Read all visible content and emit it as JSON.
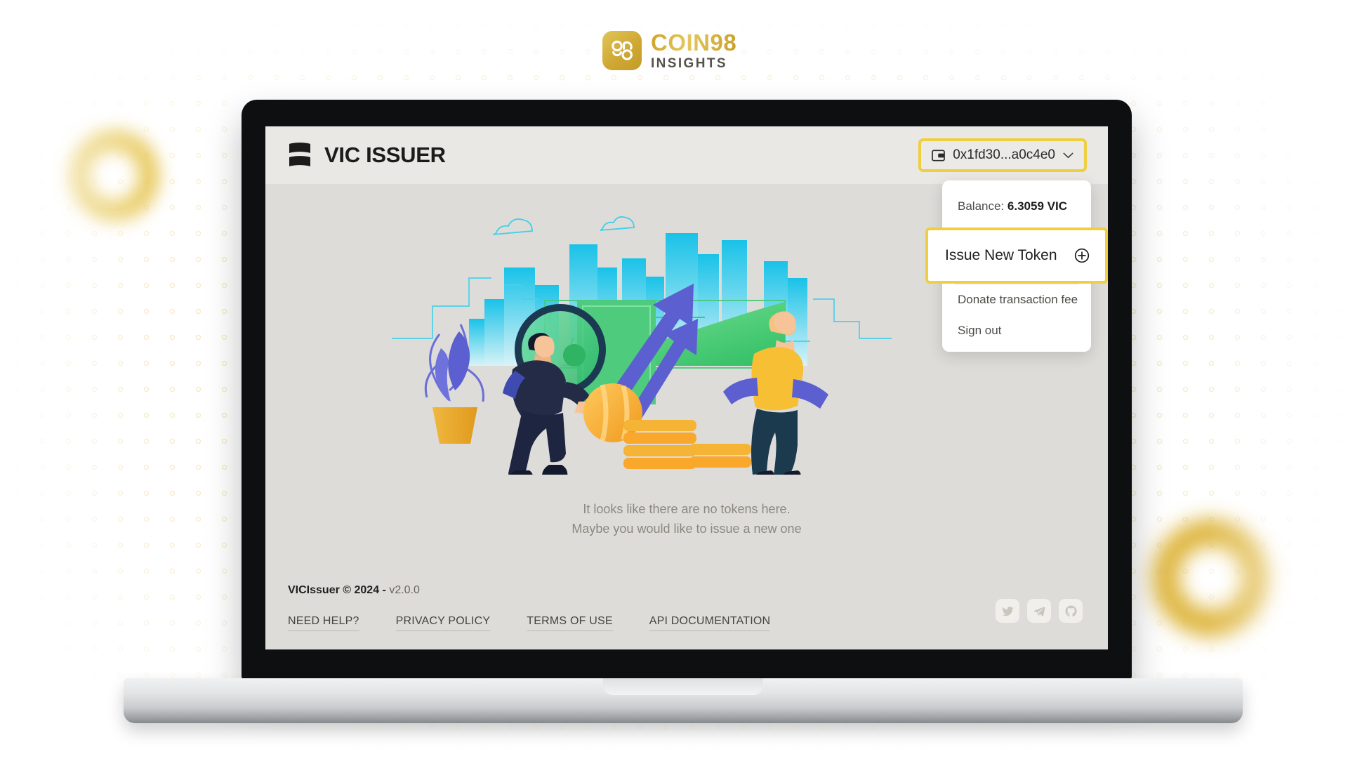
{
  "brand": {
    "mark_icon": "coin98-logo-icon",
    "title": "COIN98",
    "subtitle": "INSIGHTS",
    "gold": "#cfa32a"
  },
  "app": {
    "header": {
      "logo_icon": "vic-logo-icon",
      "title": "VIC ISSUER",
      "wallet": {
        "icon": "wallet-icon",
        "address": "0x1fd30...a0c4e0",
        "chevron": "∨",
        "highlight_color": "#efcf40"
      }
    },
    "dropdown": {
      "balance_label": "Balance:",
      "balance_value": "6.3059 VIC",
      "issue_new_token": "Issue New Token",
      "issue_icon": "plus-circle-icon",
      "donate": "Donate transaction fee",
      "sign_out": "Sign out"
    },
    "main": {
      "illustration_name": "empty-tokens-illustration",
      "empty_line1": "It looks like there are no tokens here.",
      "empty_line2": "Maybe you would like to issue a new one"
    },
    "footer": {
      "copyright": "VICIssuer © 2024 - ",
      "version": "v2.0.0",
      "links": [
        {
          "label": "NEED HELP?"
        },
        {
          "label": "PRIVACY POLICY"
        },
        {
          "label": "TERMS OF USE"
        },
        {
          "label": "API DOCUMENTATION"
        }
      ],
      "socials": [
        {
          "name": "twitter-icon"
        },
        {
          "name": "telegram-icon"
        },
        {
          "name": "github-icon"
        }
      ]
    }
  },
  "decor": {
    "ring_left": "gold-ring-decoration",
    "ring_right": "gold-ring-decoration",
    "dots": "dotted-ring-background-pattern"
  }
}
